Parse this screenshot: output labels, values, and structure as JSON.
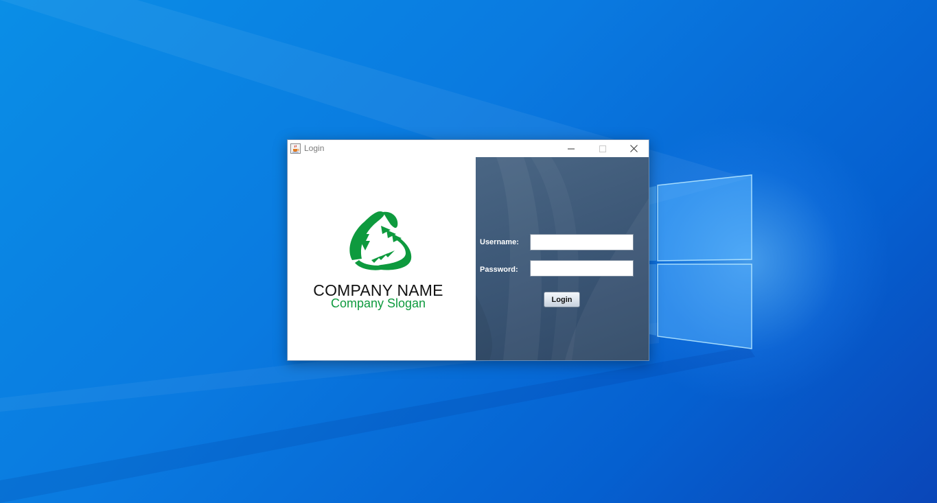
{
  "window": {
    "title": "Login",
    "app_icon": "java-cup-icon",
    "controls": [
      "minimize-icon",
      "maximize-icon",
      "close-icon"
    ]
  },
  "branding": {
    "company_name": "COMPANY NAME",
    "company_slogan": "Company Slogan",
    "logo_icon": "recycle-arrows-icon",
    "logo_color": "#0e9a3e"
  },
  "form": {
    "username_label": "Username:",
    "username_value": "",
    "password_label": "Password:",
    "password_value": "",
    "login_button": "Login"
  },
  "colors": {
    "desktop_bg": "#0a7ae0",
    "form_panel_bg": "#3d5877"
  }
}
